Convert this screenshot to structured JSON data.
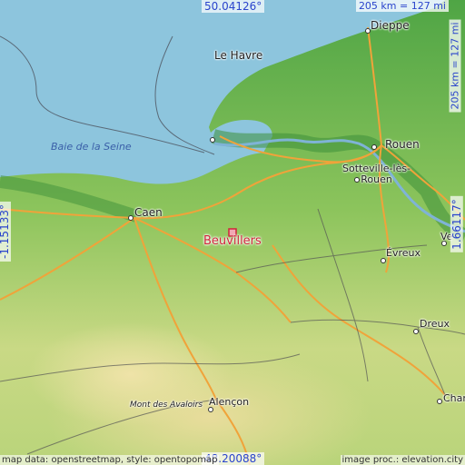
{
  "map": {
    "coords": {
      "top": "50.04126°",
      "bottom": "48.20088°",
      "left": "-1.15133°",
      "right": "1.66117°"
    },
    "scale": {
      "horizontal": "205 km = 127 mi",
      "vertical": "205 km = 127 mi"
    },
    "attribution": {
      "left": "map data: openstreetmap, style: opentopomap",
      "right": "image proc.: elevation.city"
    },
    "target_place": "Beuvillers",
    "places": [
      {
        "id": "dieppe",
        "label": "Dieppe"
      },
      {
        "id": "le-havre",
        "label": "Le Havre"
      },
      {
        "id": "rouen",
        "label": "Rouen"
      },
      {
        "id": "sotteville",
        "label": "Sotteville-lès-\nRouen"
      },
      {
        "id": "caen",
        "label": "Caen"
      },
      {
        "id": "evreux",
        "label": "Évreux"
      },
      {
        "id": "dreux",
        "label": "Dreux"
      },
      {
        "id": "alencon",
        "label": "Alençon"
      },
      {
        "id": "chartres",
        "label": "Chartr"
      },
      {
        "id": "vernon",
        "label": "Ve"
      }
    ],
    "sea_label": "Baie de la Seine",
    "relief_label": "Mont des Avaloirs"
  },
  "colors": {
    "sea": "#8dc5dd",
    "lowland": "#5aad4a",
    "midland": "#a9cf6c",
    "upland": "#e6dc96",
    "road_major": "#f0a33a",
    "road_minor": "#555555",
    "target": "#d0253b",
    "coord_text": "#2a44cc"
  }
}
